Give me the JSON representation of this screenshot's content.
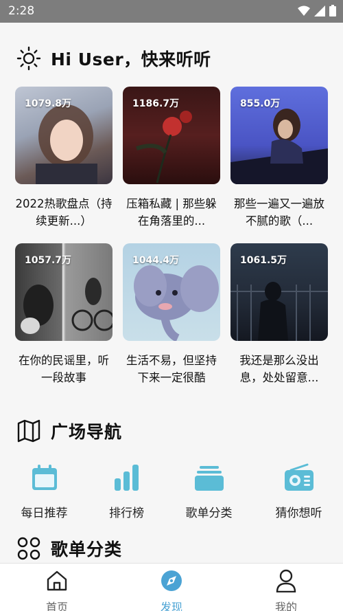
{
  "status": {
    "time": "2:28"
  },
  "greeting": {
    "title": "Hi User，快来听听"
  },
  "playlists": [
    {
      "count": "1079.8万",
      "caption": "2022热歌盘点（持续更新...）"
    },
    {
      "count": "1186.7万",
      "caption": "压箱私藏 | 那些躲在角落里的..."
    },
    {
      "count": "855.0万",
      "caption": "那些一遍又一遍放不腻的歌（..."
    },
    {
      "count": "1057.7万",
      "caption": "在你的民谣里，听一段故事"
    },
    {
      "count": "1044.4万",
      "caption": "生活不易，但坚持下来一定很酷"
    },
    {
      "count": "1061.5万",
      "caption": "我还是那么没出息，处处留意..."
    }
  ],
  "plaza": {
    "title": "广场导航",
    "items": [
      {
        "label": "每日推荐",
        "icon": "calendar-icon"
      },
      {
        "label": "排行榜",
        "icon": "ranking-icon"
      },
      {
        "label": "歌单分类",
        "icon": "playlist-stack-icon"
      },
      {
        "label": "猜你想听",
        "icon": "radio-icon"
      }
    ]
  },
  "category": {
    "title": "歌单分类"
  },
  "tabs": [
    {
      "label": "首页",
      "icon": "home-icon"
    },
    {
      "label": "发现",
      "icon": "discover-icon"
    },
    {
      "label": "我的",
      "icon": "profile-icon"
    }
  ],
  "colors": {
    "accent": "#4ba3d4",
    "nav_icon": "#5bbcd6",
    "status_bar": "#7d7d7d"
  }
}
